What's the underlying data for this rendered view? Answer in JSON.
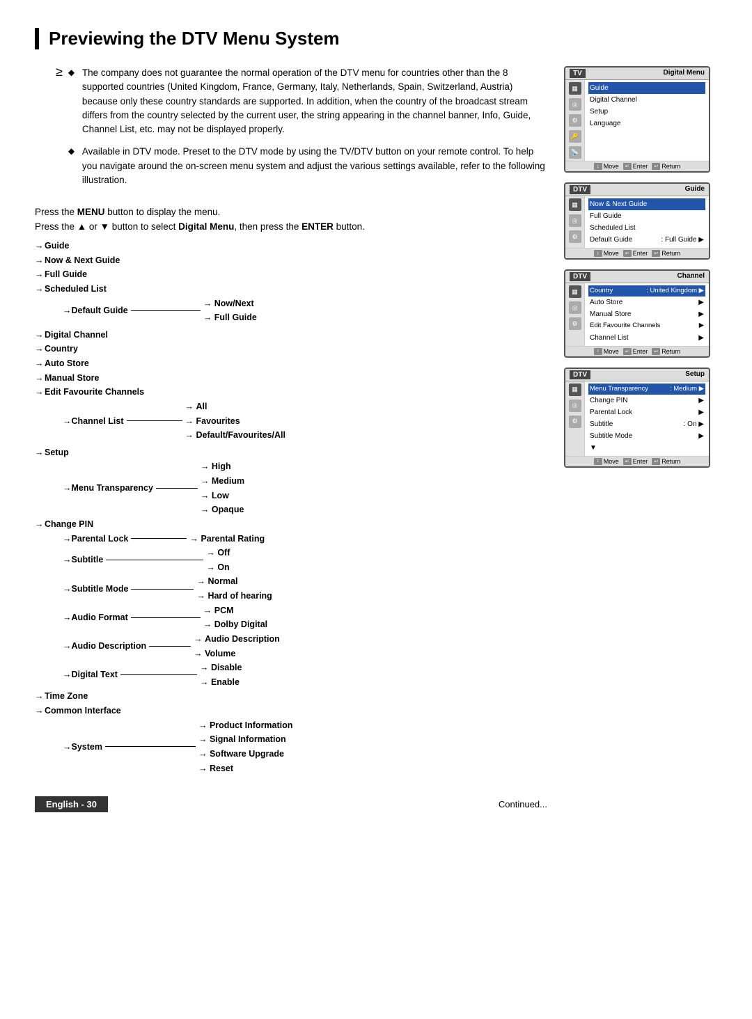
{
  "page": {
    "title": "Previewing the DTV Menu System",
    "bullets": [
      "The company does not guarantee the normal operation of the DTV menu for countries other than the 8 supported countries (United Kingdom, France, Germany, Italy, Netherlands, Spain, Switzerland, Austria) because only these country standards are supported. In addition, when the country of the broadcast stream differs from the country selected by the current user, the string appearing in the channel banner, Info, Guide, Channel List, etc. may not be displayed properly.",
      "Available in DTV mode. Preset to the DTV mode by using the TV/DTV button on your remote control. To help you navigate around the on-screen menu system and adjust the various settings available, refer to the following illustration."
    ],
    "press_menu": "Press the MENU button to display the menu.",
    "press_select": "Press the ▲ or ▼ button to select Digital Menu, then press the ENTER button.",
    "footer": {
      "badge": "English - 30",
      "continued": "Continued..."
    }
  },
  "screens": [
    {
      "id": "tv-screen",
      "channel": "TV",
      "title": "Digital Menu",
      "items": [
        {
          "label": "Guide",
          "highlighted": true
        },
        {
          "label": "Digital Channel",
          "highlighted": false
        },
        {
          "label": "Setup",
          "highlighted": false
        },
        {
          "label": "Language",
          "highlighted": false
        }
      ]
    },
    {
      "id": "dtv-guide-screen",
      "channel": "DTV",
      "title": "Guide",
      "items": [
        {
          "label": "Now & Next Guide",
          "highlighted": true
        },
        {
          "label": "Full Guide",
          "highlighted": false
        },
        {
          "label": "Scheduled List",
          "highlighted": false
        },
        {
          "label": "Default Guide",
          "value": ": Full Guide ▶",
          "highlighted": false
        }
      ]
    },
    {
      "id": "dtv-channel-screen",
      "channel": "DTV",
      "title": "Channel",
      "items": [
        {
          "label": "Country",
          "value": ": United Kingdom ▶",
          "highlighted": true
        },
        {
          "label": "Auto Store",
          "value": "▶",
          "highlighted": false
        },
        {
          "label": "Manual Store",
          "value": "▶",
          "highlighted": false
        },
        {
          "label": "Edit Favourite Channels",
          "value": "▶",
          "highlighted": false
        },
        {
          "label": "Channel List",
          "value": "▶",
          "highlighted": false
        }
      ]
    },
    {
      "id": "dtv-setup-screen",
      "channel": "DTV",
      "title": "Setup",
      "items": [
        {
          "label": "Menu Transparency",
          "value": ": Medium ▶",
          "highlighted": true
        },
        {
          "label": "Change PIN",
          "value": "▶",
          "highlighted": false
        },
        {
          "label": "Parental Lock",
          "value": "▶",
          "highlighted": false
        },
        {
          "label": "Subtitle",
          "value": ": On ▶",
          "highlighted": false
        },
        {
          "label": "Subtitle Mode",
          "value": "▶",
          "highlighted": false
        },
        {
          "label": "▼",
          "highlighted": false
        }
      ]
    }
  ],
  "tree": {
    "guide": {
      "label": "Guide",
      "children": [
        "Now & Next Guide",
        "Full Guide",
        "Scheduled List",
        {
          "label": "Default Guide",
          "branches": [
            "Now/Next",
            "Full Guide"
          ]
        }
      ]
    },
    "digital_channel": {
      "label": "Digital Channel",
      "children": [
        "Country",
        "Auto Store",
        "Manual Store",
        "Edit Favourite Channels",
        {
          "label": "Channel List",
          "branches": [
            "All",
            "Favourites",
            "Default/Favourites/All"
          ]
        }
      ]
    },
    "setup": {
      "label": "Setup",
      "children": [
        {
          "label": "Menu Transparency",
          "branches": [
            "High",
            "Medium",
            "Low",
            "Opaque"
          ]
        },
        "Change PIN",
        {
          "label": "Parental Lock",
          "branches": [
            "Parental Rating"
          ]
        },
        {
          "label": "Subtitle",
          "branches": [
            "Off",
            "On"
          ]
        },
        {
          "label": "Subtitle Mode",
          "branches": [
            "Normal",
            "Hard of hearing"
          ]
        },
        {
          "label": "Audio Format",
          "branches": [
            "PCM",
            "Dolby Digital"
          ]
        },
        {
          "label": "Audio Description",
          "branches": [
            "Audio Description",
            "Volume"
          ]
        },
        {
          "label": "Digital Text",
          "branches": [
            "Disable",
            "Enable"
          ]
        },
        "Time Zone",
        "Common Interface",
        {
          "label": "System",
          "branches": [
            "Product Information",
            "Signal Information",
            "Software Upgrade",
            "Reset"
          ]
        }
      ]
    }
  }
}
